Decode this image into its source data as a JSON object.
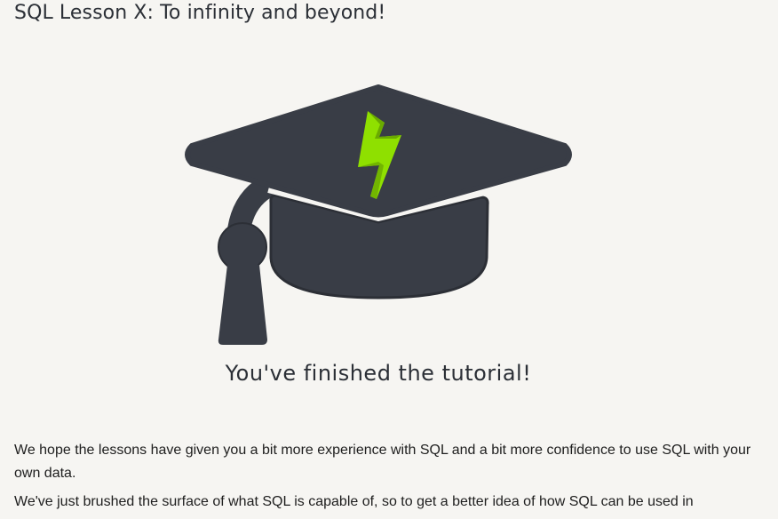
{
  "lesson": {
    "title": "SQL Lesson X: To infinity and beyond!"
  },
  "illustration": {
    "icon": "graduation-cap-icon",
    "cap_color": "#393d46",
    "bolt_color": "#8fe000"
  },
  "completion": {
    "heading": "You've finished the tutorial!"
  },
  "paragraphs": [
    "We hope the lessons have given you a bit more experience with SQL and a bit more confidence to use SQL with your own data.",
    "We've just brushed the surface of what SQL is capable of, so to get a better idea of how SQL can be used in"
  ]
}
